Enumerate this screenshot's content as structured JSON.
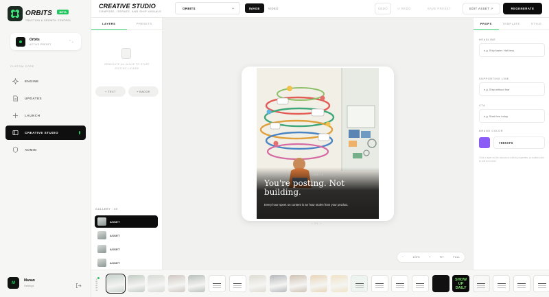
{
  "brand": {
    "name": "ORBITS",
    "badge": "BETA",
    "tagline": "TRACTION & GROWTH CONTROL"
  },
  "preset": {
    "name": "Orbits",
    "subtitle": "ACTIVE PRESET"
  },
  "nav": {
    "section_label": "CUSTOM CODE",
    "items": [
      {
        "label": "ENGINE",
        "icon": "sparkle-icon"
      },
      {
        "label": "UPDATES",
        "icon": "document-icon"
      },
      {
        "label": "LAUNCH",
        "icon": "plus-icon"
      },
      {
        "label": "CREATIVE STUDIO",
        "icon": "studio-icon",
        "active": true
      },
      {
        "label": "ADMIN",
        "icon": "shield-icon"
      }
    ]
  },
  "user": {
    "name": "Manan",
    "subtitle": "Settings",
    "initial": "M"
  },
  "header": {
    "title": "CREATIVE STUDIO",
    "subtitle": "COMPOSE, ITERATE, AND SHIP VISUALS",
    "preset_select": "ORBITS",
    "mode_tabs": [
      "IMAGE",
      "VIDEO"
    ],
    "undo_label": "UNDO",
    "redo_label": "↺ REDO",
    "save_preset_label": "SAVE PRESET",
    "edit_asset_label": "EDIT ASSET ↗",
    "regenerate_label": "REGENERATE"
  },
  "layers_panel": {
    "tabs": [
      "LAYERS",
      "PRESETS"
    ],
    "empty_text": "GENERATE AN IMAGE TO START EDITING LAYERS",
    "add_text_label": "+ TEXT",
    "add_badge_label": "+ BADGE",
    "gallery_label": "GALLERY · 55",
    "gallery_items": [
      "ASSET",
      "ASSET",
      "ASSET",
      "ASSET"
    ]
  },
  "canvas": {
    "kicker": "ORBITS",
    "headline": "You're posting. Not building.",
    "supporting": "Every hour spent on content is an hour stolen from your product.",
    "pager": "• 01 •",
    "zoom": {
      "minus": "−",
      "percent": "100%",
      "plus": "+",
      "fit": "FIT",
      "full": "FULL"
    }
  },
  "props_panel": {
    "tabs": [
      "PROPS",
      "TEMPLATE",
      "STYLE"
    ],
    "headline_label": "HEADLINE",
    "headline_placeholder": "e.g. Ship faster. Halt less.",
    "supporting_label": "SUPPORTING LINE",
    "supporting_placeholder": "e.g. Ship without fear",
    "cta_label": "CTA",
    "cta_placeholder": "e.g. Start free today",
    "brand_color_label": "BRAND COLOR",
    "brand_color_hex": "#8B5CF6",
    "help_text": "Click a layer on the canvas to edit its properties, or double click to edit text inline."
  },
  "filmstrip": {
    "label": "LIBRARY",
    "thumbs": [
      {
        "type": "photo",
        "bg": "#c9d3cc",
        "active": true
      },
      {
        "type": "photo",
        "bg": "#c2cbc4"
      },
      {
        "type": "photo",
        "bg": "#d7dad5"
      },
      {
        "type": "photo",
        "bg": "#cfc8c2"
      },
      {
        "type": "photo",
        "bg": "#b9c0bc"
      },
      {
        "type": "doc",
        "bg": "#ffffff"
      },
      {
        "type": "doc",
        "bg": "#ffffff"
      },
      {
        "type": "photo",
        "bg": "#dedcd2"
      },
      {
        "type": "photo",
        "bg": "#b5b8bb"
      },
      {
        "type": "photo",
        "bg": "#cfc2b3"
      },
      {
        "type": "photo",
        "bg": "#e8d6b8"
      },
      {
        "type": "photo",
        "bg": "#f1e3c6"
      },
      {
        "type": "doc",
        "bg": "#eef4ef"
      },
      {
        "type": "doc",
        "bg": "#ffffff"
      },
      {
        "type": "doc",
        "bg": "#ffffff"
      },
      {
        "type": "doc",
        "bg": "#ffffff"
      },
      {
        "type": "dark",
        "bg": "#111111"
      },
      {
        "type": "text",
        "bg": "#0b0b0b",
        "text": "SHOW UP DAILY",
        "color": "#7ee36f"
      },
      {
        "type": "doc",
        "bg": "#f8f8f8"
      },
      {
        "type": "doc",
        "bg": "#ffffff"
      },
      {
        "type": "doc",
        "bg": "#ffffff"
      },
      {
        "type": "doc",
        "bg": "#ffffff"
      }
    ]
  },
  "colors": {
    "accent": "#22c55e",
    "brand_swatch": "#8B5CF6",
    "dark": "#0c0c0c"
  }
}
